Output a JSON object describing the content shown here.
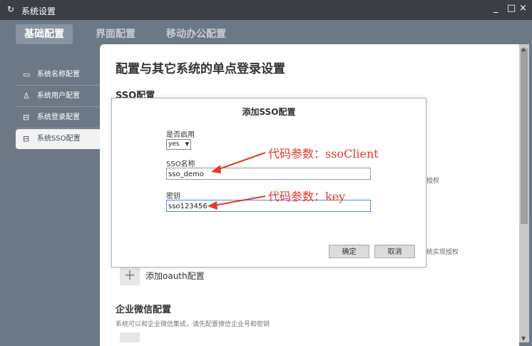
{
  "titlebar": {
    "title": "系统设置",
    "logo": "↻",
    "minimize": "_",
    "maximize": "□",
    "close": "×"
  },
  "tabs": [
    {
      "label": "基础配置",
      "active": true
    },
    {
      "label": "界面配置"
    },
    {
      "label": "移动办公配置"
    }
  ],
  "sidebar": {
    "items": [
      {
        "label": "系统名称配置",
        "icon": "name-tag-icon",
        "glyph": "▭"
      },
      {
        "label": "系统用户配置",
        "icon": "user-icon",
        "glyph": "♙"
      },
      {
        "label": "系统登录配置",
        "icon": "lock-icon",
        "glyph": "⊟"
      },
      {
        "label": "系统SSO配置",
        "icon": "lock-icon",
        "glyph": "⊟",
        "active": true
      }
    ]
  },
  "content": {
    "title": "配置与其它系统的单点登录设置",
    "sso_section": "SSO配置",
    "side_text_1": "授权",
    "side_text_2": "统实现授权",
    "add_oauth_label": "添加oauth配置",
    "wechat_section": "企业微信配置",
    "wechat_desc": "系统可以和企业微信集成，请先配置微信企业号和密钥"
  },
  "dialog": {
    "title": "添加SSO配置",
    "enabled_label": "是否启用",
    "enabled_value": "yes",
    "sso_name_label": "SSO名称",
    "sso_name_value": "sso_demo",
    "secret_label": "密钥",
    "secret_value": "sso123456",
    "confirm_label": "确定",
    "cancel_label": "取消"
  },
  "annotations": {
    "name_param": "代码参数：ssoClient",
    "key_param": "代码参数：key",
    "color": "#e23b2a"
  },
  "colors": {
    "titlebar": "#3b3f45",
    "background": "#6c7886",
    "active_tab": "#8894a2"
  }
}
